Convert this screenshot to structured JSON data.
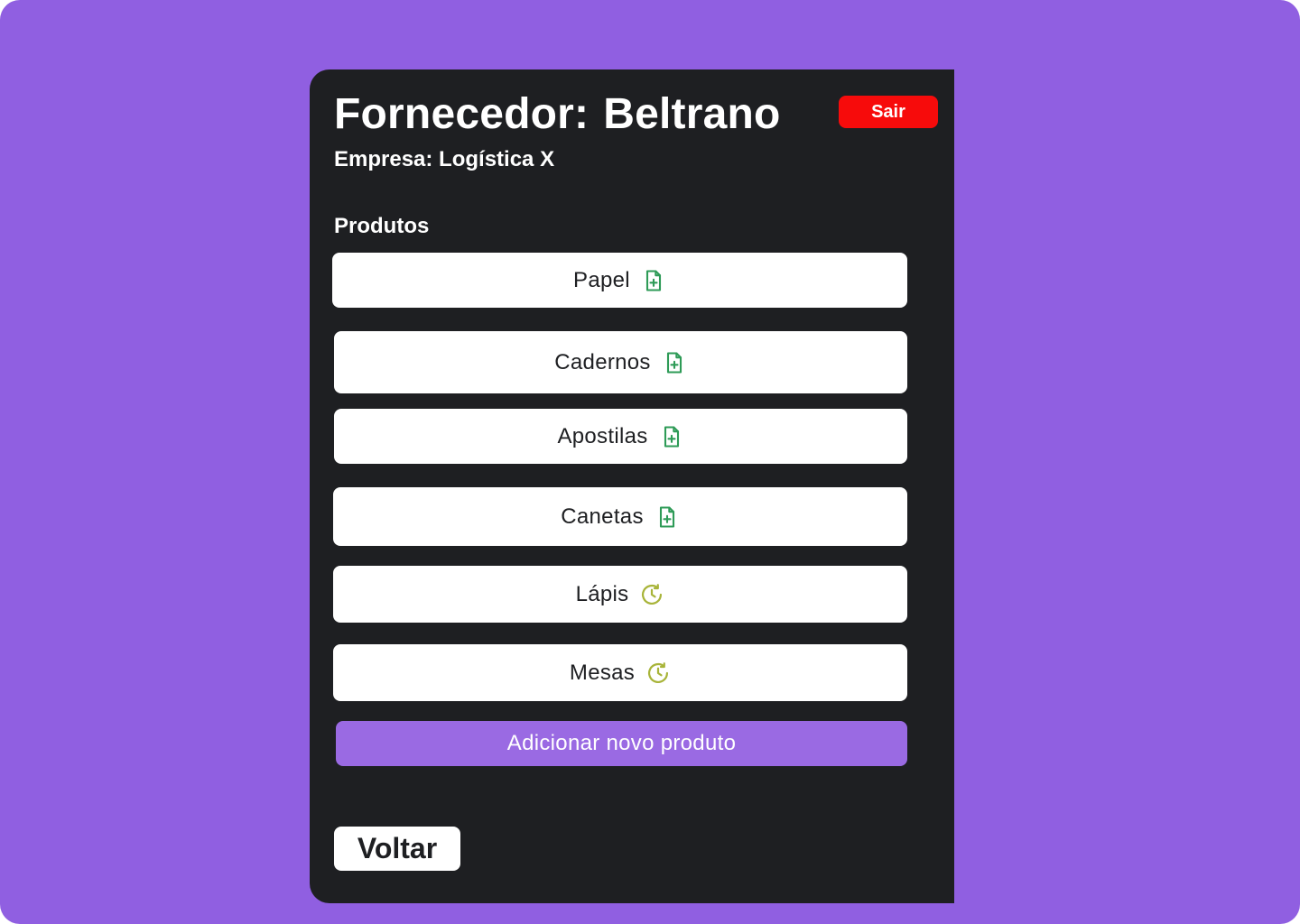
{
  "supplier": {
    "title_prefix": "Fornecedor:",
    "name": "Beltrano",
    "company": "Empresa: Logística X"
  },
  "header": {
    "logout_label": "Sair"
  },
  "products": {
    "section_title": "Produtos",
    "items": [
      {
        "label": "Papel",
        "icon": "file-plus-icon"
      },
      {
        "label": "Cadernos",
        "icon": "file-plus-icon"
      },
      {
        "label": "Apostilas",
        "icon": "file-plus-icon"
      },
      {
        "label": "Canetas",
        "icon": "file-plus-icon"
      },
      {
        "label": "Lápis",
        "icon": "clock-pending-icon"
      },
      {
        "label": "Mesas",
        "icon": "clock-pending-icon"
      }
    ],
    "add_label": "Adicionar novo produto"
  },
  "footer": {
    "back_label": "Voltar"
  },
  "colors": {
    "background": "#905FE1",
    "panel": "#1E1F22",
    "logout": "#F70B0B",
    "add_button": "#9A6AE3",
    "file_icon": "#2E9B57",
    "clock_icon": "#A8B439"
  }
}
